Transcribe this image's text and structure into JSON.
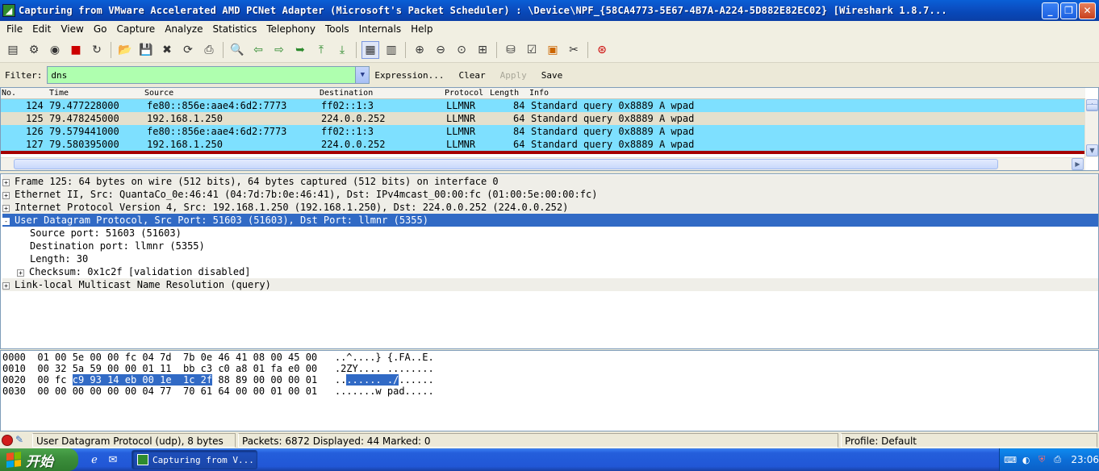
{
  "window": {
    "title": "Capturing from VMware Accelerated AMD PCNet Adapter (Microsoft's Packet Scheduler) : \\Device\\NPF_{58CA4773-5E67-4B7A-A224-5D882E82EC02}   [Wireshark 1.8.7..."
  },
  "menu": [
    "File",
    "Edit",
    "View",
    "Go",
    "Capture",
    "Analyze",
    "Statistics",
    "Telephony",
    "Tools",
    "Internals",
    "Help"
  ],
  "filter": {
    "label": "Filter:",
    "value": "dns",
    "expression": "Expression...",
    "clear": "Clear",
    "apply": "Apply",
    "save": "Save"
  },
  "packet_list": {
    "columns": [
      "No.",
      "Time",
      "Source",
      "Destination",
      "Protocol",
      "Length",
      "Info"
    ],
    "rows": [
      {
        "no": "124",
        "time": "79.477228000",
        "src": "fe80::856e:aae4:6d2:7773",
        "dst": "ff02::1:3",
        "proto": "LLMNR",
        "len": "84",
        "info": "Standard query 0x8889  A wpad"
      },
      {
        "no": "125",
        "time": "79.478245000",
        "src": "192.168.1.250",
        "dst": "224.0.0.252",
        "proto": "LLMNR",
        "len": "64",
        "info": "Standard query 0x8889  A wpad"
      },
      {
        "no": "126",
        "time": "79.579441000",
        "src": "fe80::856e:aae4:6d2:7773",
        "dst": "ff02::1:3",
        "proto": "LLMNR",
        "len": "84",
        "info": "Standard query 0x8889  A wpad"
      },
      {
        "no": "127",
        "time": "79.580395000",
        "src": "192.168.1.250",
        "dst": "224.0.0.252",
        "proto": "LLMNR",
        "len": "64",
        "info": "Standard query 0x8889  A wpad"
      }
    ]
  },
  "details": [
    {
      "text": "Frame 125: 64 bytes on wire (512 bits), 64 bytes captured (512 bits) on interface 0",
      "expander": "+"
    },
    {
      "text": "Ethernet II, Src: QuantaCo_0e:46:41 (04:7d:7b:0e:46:41), Dst: IPv4mcast_00:00:fc (01:00:5e:00:00:fc)",
      "expander": "+"
    },
    {
      "text": "Internet Protocol Version 4, Src: 192.168.1.250 (192.168.1.250), Dst: 224.0.0.252 (224.0.0.252)",
      "expander": "+"
    },
    {
      "text": "User Datagram Protocol, Src Port: 51603 (51603), Dst Port: llmnr (5355)",
      "expander": "-"
    },
    {
      "text": "Source port: 51603 (51603)"
    },
    {
      "text": "Destination port: llmnr (5355)"
    },
    {
      "text": "Length: 30"
    },
    {
      "text": "Checksum: 0x1c2f [validation disabled]",
      "expander": "+"
    },
    {
      "text": "Link-local Multicast Name Resolution (query)",
      "expander": "+"
    }
  ],
  "bytes": [
    {
      "offset": "0000",
      "hex_a": "01 00 5e 00 00 fc 04 7d",
      "hex_b": "7b 0e 46 41 08 00 45 00",
      "ascii": "..^....} {.FA..E."
    },
    {
      "offset": "0010",
      "hex_a": "00 32 5a 59 00 00 01 11",
      "hex_b": "bb c3 c0 a8 01 fa e0 00",
      "ascii": ".2ZY.... ........"
    },
    {
      "offset": "0020",
      "hex_pre": "00 fc ",
      "hex_hl_a": "c9 93 14 eb 00 1e",
      "hex_hl_b": "1c 2f",
      "hex_b": "88 89 00 00 00 01",
      "ascii_pre": "..",
      "ascii_hl": "...... ./",
      "ascii_post": "......"
    },
    {
      "offset": "0030",
      "hex_a": "00 00 00 00 00 00 04 77",
      "hex_b": "70 61 64 00 00 01 00 01",
      "ascii": ".......w pad....."
    }
  ],
  "status": {
    "field": "User Datagram Protocol (udp), 8 bytes",
    "packets": "Packets: 6872 Displayed: 44 Marked: 0",
    "profile": "Profile: Default"
  },
  "taskbar": {
    "start": "开始",
    "task": "Capturing from V...",
    "clock": "23:06"
  },
  "icons": {
    "app": "wireshark-fin-icon",
    "quicklaunch": [
      "ie-icon",
      "outlook-icon"
    ]
  }
}
